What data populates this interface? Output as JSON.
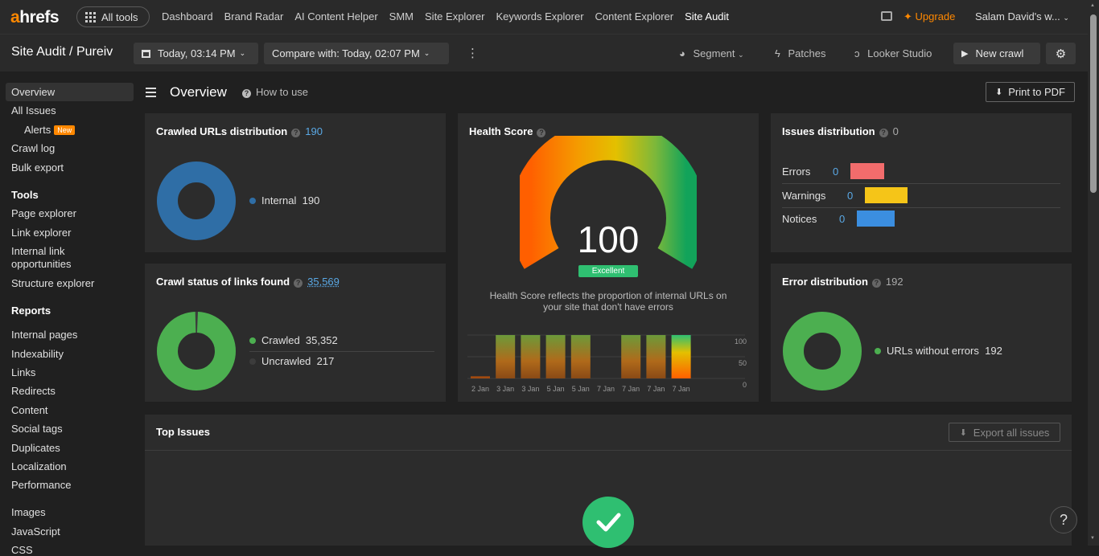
{
  "brand": {
    "logo_a": "a",
    "logo_rest": "hrefs",
    "all_tools": "All tools"
  },
  "nav": [
    "Dashboard",
    "Brand Radar",
    "AI Content Helper",
    "SMM",
    "Site Explorer",
    "Keywords Explorer",
    "Content Explorer",
    "Site Audit"
  ],
  "nav_active_index": 7,
  "topright": {
    "upgrade": "Upgrade",
    "user": "Salam David's w..."
  },
  "toolbar": {
    "breadcrumb": "Site Audit / Pureiv",
    "date": "Today, 03:14 PM",
    "compare": "Compare with: Today, 02:07 PM",
    "segment": "Segment",
    "patches": "Patches",
    "looker": "Looker Studio",
    "new_crawl": "New crawl"
  },
  "sidebar": {
    "top": [
      "Overview",
      "All Issues",
      "Alerts",
      "Crawl log",
      "Bulk export"
    ],
    "new_badge": "New",
    "tools_heading": "Tools",
    "tools": [
      "Page explorer",
      "Link explorer",
      "Internal link opportunities",
      "Structure explorer"
    ],
    "reports_heading": "Reports",
    "reports": [
      "Internal pages",
      "Indexability",
      "Links",
      "Redirects",
      "Content",
      "Social tags",
      "Duplicates",
      "Localization",
      "Performance",
      "Images",
      "JavaScript",
      "CSS"
    ]
  },
  "overview": {
    "title": "Overview",
    "how_to_use": "How to use",
    "print": "Print to PDF"
  },
  "crawled_urls": {
    "title": "Crawled URLs distribution",
    "count": "190",
    "legend": "Internal",
    "legend_value": "190",
    "color": "#2f6ea6"
  },
  "crawl_status": {
    "title": "Crawl status of links found",
    "count": "35,569",
    "crawled_label": "Crawled",
    "crawled_value": "35,352",
    "uncrawled_label": "Uncrawled",
    "uncrawled_value": "217",
    "crawled_num": 35352,
    "uncrawled_num": 217
  },
  "health": {
    "title": "Health Score",
    "score": "100",
    "badge": "Excellent",
    "desc": "Health Score reflects the proportion of internal URLs on your site that don't have errors",
    "chart_data": {
      "type": "bar",
      "categories": [
        "2 Jan",
        "3 Jan",
        "3 Jan",
        "5 Jan",
        "5 Jan",
        "7 Jan",
        "7 Jan",
        "7 Jan",
        "7 Jan"
      ],
      "values": [
        5,
        100,
        100,
        100,
        100,
        0,
        100,
        100,
        100
      ],
      "ylim": [
        0,
        100
      ],
      "ticks": [
        "100",
        "50",
        "0"
      ]
    }
  },
  "issues": {
    "title": "Issues distribution",
    "count": "0",
    "rows": [
      {
        "label": "Errors",
        "value": "0",
        "color": "#f26c6c"
      },
      {
        "label": "Warnings",
        "value": "0",
        "color": "#f5c518"
      },
      {
        "label": "Notices",
        "value": "0",
        "color": "#3b8ee0"
      }
    ]
  },
  "errors": {
    "title": "Error distribution",
    "count": "192",
    "legend": "URLs without errors",
    "legend_value": "192",
    "color": "#4caf50"
  },
  "top_issues": {
    "title": "Top Issues",
    "export": "Export all issues"
  }
}
